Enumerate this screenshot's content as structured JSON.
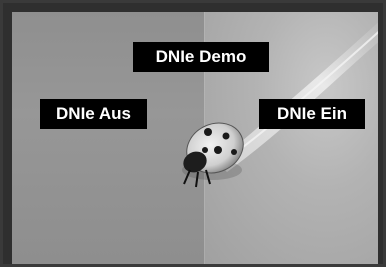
{
  "overlay": {
    "title_label": "DNIe Demo",
    "left_label": "DNIe Aus",
    "right_label": "DNIe Ein"
  },
  "image": {
    "subject": "ladybug-on-leaf-photo"
  },
  "colors": {
    "label_background": "#000000",
    "label_text": "#ffffff",
    "frame": "#3a3a3a"
  }
}
